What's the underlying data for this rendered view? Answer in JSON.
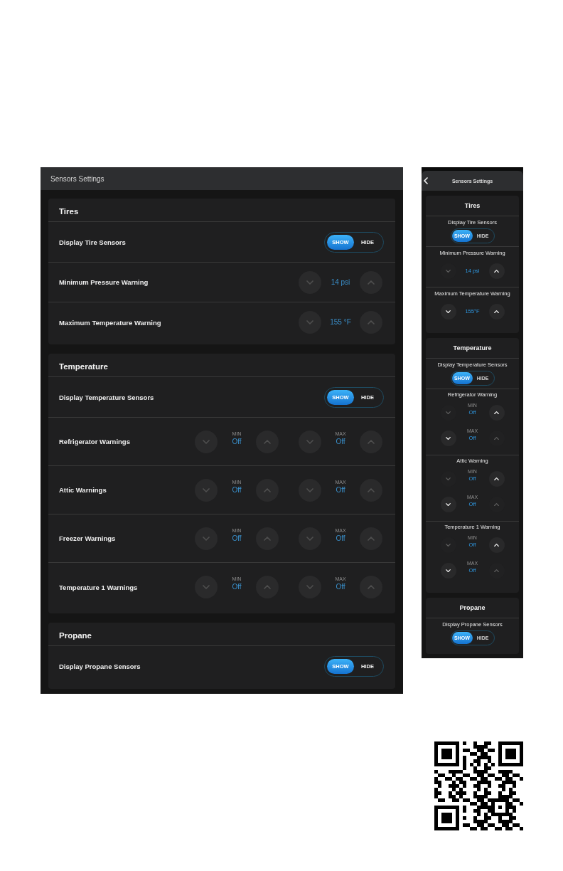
{
  "tablet": {
    "title": "Sensors Settings",
    "sections": [
      {
        "title": "Tires",
        "rows": [
          {
            "kind": "toggle",
            "label": "Display Tire Sensors",
            "options": [
              {
                "label": "SHOW",
                "selected": true
              },
              {
                "label": "HIDE",
                "selected": false
              }
            ]
          },
          {
            "kind": "stepper",
            "label": "Minimum Pressure Warning",
            "value": "14 psi"
          },
          {
            "kind": "stepper",
            "label": "Maximum Temperature Warning",
            "value": "155 °F"
          }
        ]
      },
      {
        "title": "Temperature",
        "rows": [
          {
            "kind": "toggle",
            "label": "Display Temperature Sensors",
            "options": [
              {
                "label": "SHOW",
                "selected": true
              },
              {
                "label": "HIDE",
                "selected": false
              }
            ]
          },
          {
            "kind": "range",
            "label": "Refrigerator Warnings",
            "bounds": [
              {
                "label": "MIN",
                "value": "Off"
              },
              {
                "label": "MAX",
                "value": "Off"
              }
            ]
          },
          {
            "kind": "range",
            "label": "Attic Warnings",
            "bounds": [
              {
                "label": "MIN",
                "value": "Off"
              },
              {
                "label": "MAX",
                "value": "Off"
              }
            ]
          },
          {
            "kind": "range",
            "label": "Freezer Warnings",
            "bounds": [
              {
                "label": "MIN",
                "value": "Off"
              },
              {
                "label": "MAX",
                "value": "Off"
              }
            ]
          },
          {
            "kind": "range",
            "label": "Temperature 1 Warnings",
            "bounds": [
              {
                "label": "MIN",
                "value": "Off"
              },
              {
                "label": "MAX",
                "value": "Off"
              }
            ]
          }
        ]
      },
      {
        "title": "Propane",
        "rows": [
          {
            "kind": "toggle",
            "label": "Display Propane Sensors",
            "options": [
              {
                "label": "SHOW",
                "selected": true
              },
              {
                "label": "HIDE",
                "selected": false
              }
            ]
          }
        ]
      }
    ]
  },
  "phone": {
    "title": "Sensors Settings",
    "sections": [
      {
        "title": "Tires",
        "rows": [
          {
            "kind": "toggle",
            "label": "Display Tire Sensors",
            "options": [
              {
                "label": "SHOW",
                "selected": true
              },
              {
                "label": "HIDE",
                "selected": false
              }
            ]
          },
          {
            "kind": "stepper",
            "label": "Minimum Pressure Warning",
            "value": "14 psi",
            "down_disabled": true,
            "up_disabled": false
          },
          {
            "kind": "stepper",
            "label": "Maximum Temperature Warning",
            "value": "155°F",
            "down_disabled": false,
            "up_disabled": false
          }
        ]
      },
      {
        "title": "Temperature",
        "rows": [
          {
            "kind": "toggle",
            "label": "Display Temperature Sensors",
            "options": [
              {
                "label": "SHOW",
                "selected": true
              },
              {
                "label": "HIDE",
                "selected": false
              }
            ]
          },
          {
            "kind": "range",
            "label": "Refrigerator Warning",
            "bounds": [
              {
                "label": "MIN",
                "value": "Off",
                "down_disabled": true,
                "up_disabled": false
              },
              {
                "label": "MAX",
                "value": "Off",
                "down_disabled": false,
                "up_disabled": true
              }
            ]
          },
          {
            "kind": "range",
            "label": "Attic Warning",
            "bounds": [
              {
                "label": "MIN",
                "value": "Off",
                "down_disabled": true,
                "up_disabled": false
              },
              {
                "label": "MAX",
                "value": "Off",
                "down_disabled": false,
                "up_disabled": true
              }
            ]
          },
          {
            "kind": "range",
            "label": "Temperature 1 Warning",
            "bounds": [
              {
                "label": "MIN",
                "value": "Off",
                "down_disabled": true,
                "up_disabled": false
              },
              {
                "label": "MAX",
                "value": "Off",
                "down_disabled": false,
                "up_disabled": true
              }
            ]
          }
        ]
      },
      {
        "title": "Propane",
        "rows": [
          {
            "kind": "toggle",
            "label": "Display Propane Sensors",
            "options": [
              {
                "label": "SHOW",
                "selected": true
              },
              {
                "label": "HIDE",
                "selected": false
              }
            ]
          }
        ]
      }
    ]
  }
}
